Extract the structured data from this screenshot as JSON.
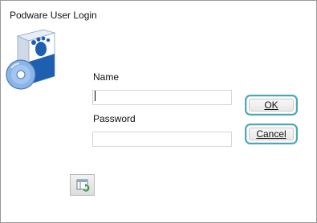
{
  "window": {
    "title": "Podware User Login"
  },
  "form": {
    "name_label": "Name",
    "name_value": "",
    "password_label": "Password",
    "password_value": ""
  },
  "buttons": {
    "ok_label": "OK",
    "cancel_label": "Cancel"
  },
  "icons": {
    "logo": "software-box-icon",
    "small_button": "window-refresh-icon"
  },
  "colors": {
    "button_border": "#4aa7b7",
    "box_blue": "#1f5fb0",
    "disc_blue": "#8bb4e8"
  }
}
